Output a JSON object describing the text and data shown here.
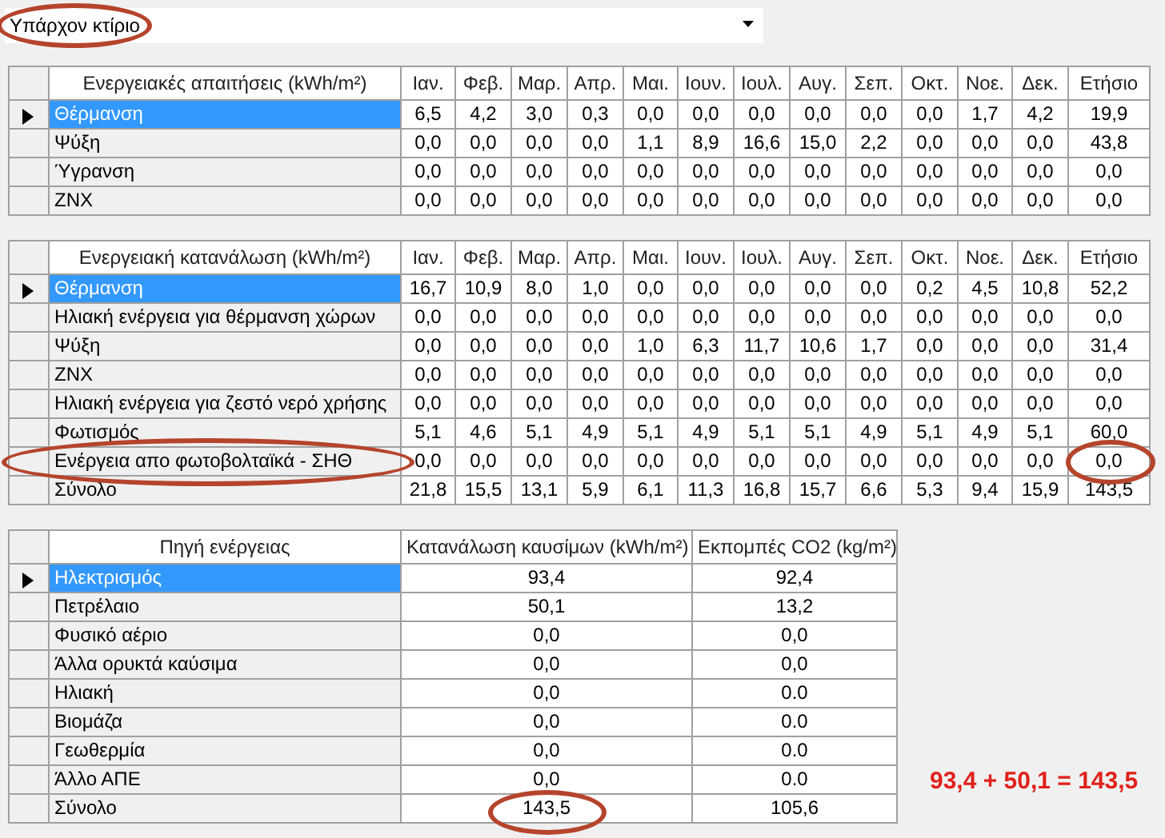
{
  "building_select": {
    "value": "Υπάρχον κτίριο",
    "circled": true
  },
  "demand_table": {
    "columns": [
      "Ενεργειακές απαιτήσεις (kWh/m²)",
      "Ιαν.",
      "Φεβ.",
      "Μαρ.",
      "Απρ.",
      "Μαι.",
      "Ιουν.",
      "Ιουλ.",
      "Αυγ.",
      "Σεπ.",
      "Οκτ.",
      "Νοε.",
      "Δεκ.",
      "Ετήσιο"
    ],
    "rows": [
      {
        "label": "Θέρμανση",
        "selected": true,
        "values": [
          "6,5",
          "4,2",
          "3,0",
          "0,3",
          "0,0",
          "0,0",
          "0,0",
          "0,0",
          "0,0",
          "0,0",
          "1,7",
          "4,2",
          "19,9"
        ]
      },
      {
        "label": "Ψύξη",
        "selected": false,
        "values": [
          "0,0",
          "0,0",
          "0,0",
          "0,0",
          "1,1",
          "8,9",
          "16,6",
          "15,0",
          "2,2",
          "0,0",
          "0,0",
          "0,0",
          "43,8"
        ]
      },
      {
        "label": "Ύγρανση",
        "selected": false,
        "values": [
          "0,0",
          "0,0",
          "0,0",
          "0,0",
          "0,0",
          "0,0",
          "0,0",
          "0,0",
          "0,0",
          "0,0",
          "0,0",
          "0,0",
          "0,0"
        ]
      },
      {
        "label": "ΖΝΧ",
        "selected": false,
        "values": [
          "0,0",
          "0,0",
          "0,0",
          "0,0",
          "0,0",
          "0,0",
          "0,0",
          "0,0",
          "0,0",
          "0,0",
          "0,0",
          "0,0",
          "0,0"
        ]
      }
    ]
  },
  "consumption_table": {
    "columns": [
      "Ενεργειακή κατανάλωση (kWh/m²)",
      "Ιαν.",
      "Φεβ.",
      "Μαρ.",
      "Απρ.",
      "Μαι.",
      "Ιουν.",
      "Ιουλ.",
      "Αυγ.",
      "Σεπ.",
      "Οκτ.",
      "Νοε.",
      "Δεκ.",
      "Ετήσιο"
    ],
    "rows": [
      {
        "label": "Θέρμανση",
        "selected": true,
        "label_circled": false,
        "annual_circled": false,
        "values": [
          "16,7",
          "10,9",
          "8,0",
          "1,0",
          "0,0",
          "0,0",
          "0,0",
          "0,0",
          "0,0",
          "0,2",
          "4,5",
          "10,8",
          "52,2"
        ]
      },
      {
        "label": "Ηλιακή ενέργεια για θέρμανση χώρων",
        "selected": false,
        "label_circled": false,
        "annual_circled": false,
        "values": [
          "0,0",
          "0,0",
          "0,0",
          "0,0",
          "0,0",
          "0,0",
          "0,0",
          "0,0",
          "0,0",
          "0,0",
          "0,0",
          "0,0",
          "0,0"
        ]
      },
      {
        "label": "Ψύξη",
        "selected": false,
        "label_circled": false,
        "annual_circled": false,
        "values": [
          "0,0",
          "0,0",
          "0,0",
          "0,0",
          "1,0",
          "6,3",
          "11,7",
          "10,6",
          "1,7",
          "0,0",
          "0,0",
          "0,0",
          "31,4"
        ]
      },
      {
        "label": "ΖΝΧ",
        "selected": false,
        "label_circled": false,
        "annual_circled": false,
        "values": [
          "0,0",
          "0,0",
          "0,0",
          "0,0",
          "0,0",
          "0,0",
          "0,0",
          "0,0",
          "0,0",
          "0,0",
          "0,0",
          "0,0",
          "0,0"
        ]
      },
      {
        "label": "Ηλιακή ενέργεια για ζεστό νερό χρήσης",
        "selected": false,
        "label_circled": false,
        "annual_circled": false,
        "values": [
          "0,0",
          "0,0",
          "0,0",
          "0,0",
          "0,0",
          "0,0",
          "0,0",
          "0,0",
          "0,0",
          "0,0",
          "0,0",
          "0,0",
          "0,0"
        ]
      },
      {
        "label": "Φωτισμός",
        "selected": false,
        "label_circled": false,
        "annual_circled": false,
        "values": [
          "5,1",
          "4,6",
          "5,1",
          "4,9",
          "5,1",
          "4,9",
          "5,1",
          "5,1",
          "4,9",
          "5,1",
          "4,9",
          "5,1",
          "60,0"
        ]
      },
      {
        "label": "Ενέργεια απο φωτοβολταϊκά - ΣΗΘ",
        "selected": false,
        "label_circled": true,
        "annual_circled": true,
        "values": [
          "0,0",
          "0,0",
          "0,0",
          "0,0",
          "0,0",
          "0,0",
          "0,0",
          "0,0",
          "0,0",
          "0,0",
          "0,0",
          "0,0",
          "0,0"
        ]
      },
      {
        "label": "Σύνολο",
        "selected": false,
        "label_circled": false,
        "annual_circled": false,
        "values": [
          "21,8",
          "15,5",
          "13,1",
          "5,9",
          "6,1",
          "11,3",
          "16,8",
          "15,7",
          "6,6",
          "5,3",
          "9,4",
          "15,9",
          "143,5"
        ]
      }
    ]
  },
  "source_table": {
    "columns": [
      "Πηγή ενέργειας",
      "Κατανάλωση καυσίμων (kWh/m²)",
      "Εκπομπές CO2 (kg/m²)"
    ],
    "rows": [
      {
        "label": "Ηλεκτρισμός",
        "selected": true,
        "fuel_circled": false,
        "values": [
          "93,4",
          "92,4"
        ]
      },
      {
        "label": "Πετρέλαιο",
        "selected": false,
        "fuel_circled": false,
        "values": [
          "50,1",
          "13,2"
        ]
      },
      {
        "label": "Φυσικό αέριο",
        "selected": false,
        "fuel_circled": false,
        "values": [
          "0,0",
          "0,0"
        ]
      },
      {
        "label": "Άλλα ορυκτά καύσιμα",
        "selected": false,
        "fuel_circled": false,
        "values": [
          "0,0",
          "0,0"
        ]
      },
      {
        "label": "Ηλιακή",
        "selected": false,
        "fuel_circled": false,
        "values": [
          "0,0",
          "0.0"
        ]
      },
      {
        "label": "Βιομάζα",
        "selected": false,
        "fuel_circled": false,
        "values": [
          "0,0",
          "0.0"
        ]
      },
      {
        "label": "Γεωθερμία",
        "selected": false,
        "fuel_circled": false,
        "values": [
          "0,0",
          "0.0"
        ]
      },
      {
        "label": "Άλλο ΑΠΕ",
        "selected": false,
        "fuel_circled": false,
        "values": [
          "0,0",
          "0.0"
        ]
      },
      {
        "label": "Σύνολο",
        "selected": false,
        "fuel_circled": true,
        "values": [
          "143,5",
          "105,6"
        ]
      }
    ]
  },
  "note": "93,4 + 50,1 = 143,5"
}
